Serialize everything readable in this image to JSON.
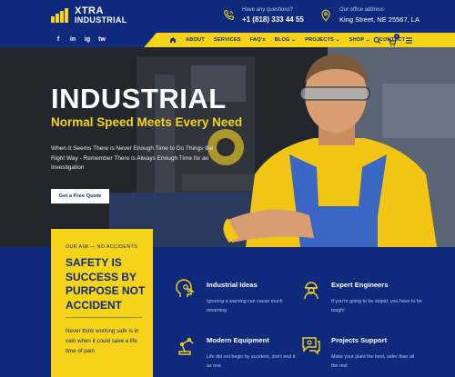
{
  "brand": {
    "line1": "XTRA",
    "line2": "INDUSTRIAL",
    "color": "#f5d319"
  },
  "header": {
    "phone": {
      "label": "Have any questions?",
      "value": "+1 (818) 333 44 55",
      "icon": "phone-icon"
    },
    "address": {
      "label": "Our office address",
      "value": "King Street, NE 25567, LA",
      "icon": "map-pin-icon"
    }
  },
  "social": [
    "f",
    "in",
    "ig",
    "tw"
  ],
  "nav": {
    "items": [
      {
        "label": "ABOUT"
      },
      {
        "label": "SERVICES"
      },
      {
        "label": "FAQ's"
      },
      {
        "label": "BLOG ⌄"
      },
      {
        "label": "PROJECTS ⌄"
      },
      {
        "label": "SHOP ⌄"
      },
      {
        "label": "CONTACT"
      }
    ],
    "cart_count": "0"
  },
  "hero": {
    "title": "INDUSTRIAL",
    "subtitle": "Normal Speed Meets Every Need",
    "text": "When It Seems There is Never Enough Time to Do Things the Right Way - Remember There is Always Enough Time for an Investigation",
    "button": "Get a Free Quote"
  },
  "aim": {
    "label": "OUR AIM — NO ACCIDENTS",
    "title": "SAFETY IS SUCCESS BY PURPOSE NOT ACCIDENT",
    "text": "Never think working safe is in vain when it could save a life time of pain"
  },
  "features": [
    {
      "title": "Industrial Ideas",
      "text": "Ignoring a warning can cause much mourning",
      "icon": "gears-head-icon"
    },
    {
      "title": "Expert Engineers",
      "text": "If you're going to be stupid, you have to be tough!",
      "icon": "engineer-icon"
    },
    {
      "title": "Modern Equipment",
      "text": "Life did not begin by accident, don't end it as one",
      "icon": "robot-arm-icon"
    },
    {
      "title": "Projects Support",
      "text": "Make your plant the best, safer than all the rest",
      "icon": "support-chat-icon"
    }
  ],
  "colors": {
    "navy": "#0f2a7c",
    "yellow": "#f5d319",
    "white": "#ffffff"
  }
}
